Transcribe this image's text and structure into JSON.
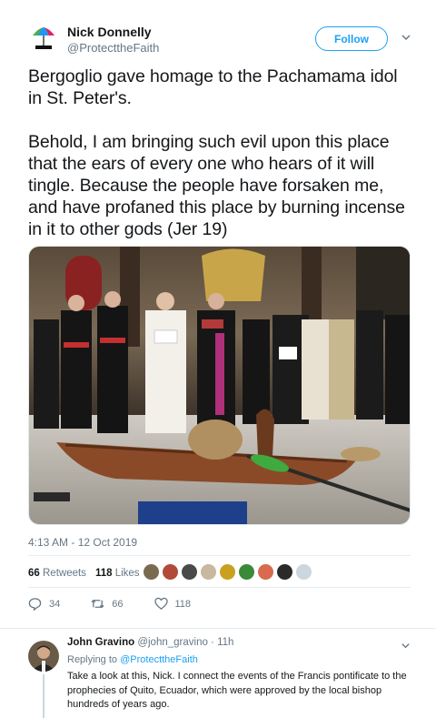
{
  "author": {
    "name": "Nick Donnelly",
    "handle": "@ProtecttheFaith",
    "avatar_icon": "umbrella-logo-icon"
  },
  "follow_label": "Follow",
  "tweet": {
    "text": "Bergoglio gave homage to the Pachamama idol in St. Peter's.\n\nBehold, I am bringing such evil upon this place that the ears of every one who hears of it will tingle. Because the people have forsaken me, and have profaned this place by burning incense in it to other gods (Jer 19)",
    "timestamp": "4:13 AM - 12 Oct 2019"
  },
  "stats": {
    "retweets_count": "66",
    "retweets_label": "Retweets",
    "likes_count": "118",
    "likes_label": "Likes"
  },
  "actions": {
    "reply_count": "34",
    "retweet_count": "66",
    "like_count": "118"
  },
  "reply": {
    "name": "John Gravino",
    "handle": "@john_gravino",
    "time": "11h",
    "replying_prefix": "Replying to",
    "replying_to": "@ProtecttheFaith",
    "text": "Take a look at this, Nick.  I connect the events of the Francis pontificate to the prophecies of Quito, Ecuador, which were approved by the local bishop hundreds of years ago."
  },
  "colors": {
    "accent": "#1da1f2",
    "secondary_text": "#657786",
    "divider": "#e6ecf0"
  }
}
